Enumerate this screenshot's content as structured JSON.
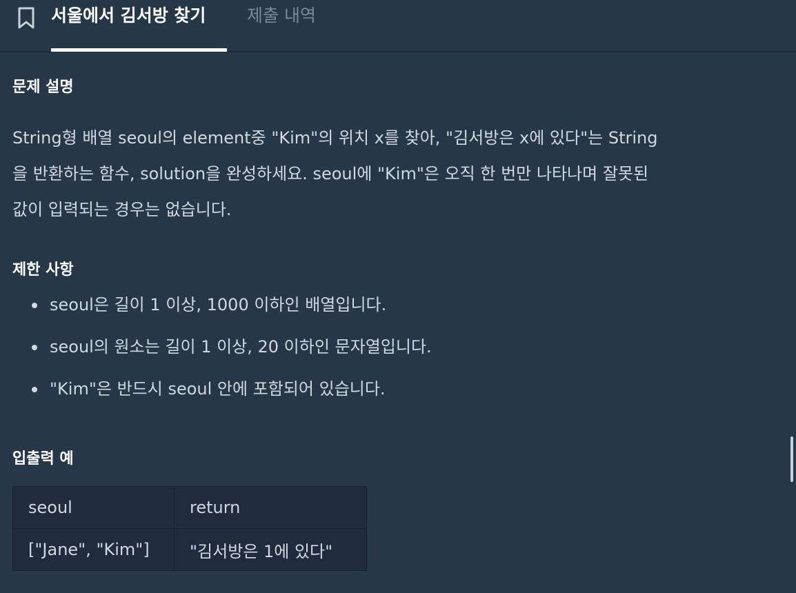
{
  "tabs": {
    "active_label": "서울에서 김서방 찾기",
    "inactive_label": "제출 내역",
    "bookmark_icon": "bookmark-icon"
  },
  "problem": {
    "description_heading": "문제 설명",
    "description_lines": [
      "String형 배열 seoul의 element중 \"Kim\"의 위치 x를 찾아, \"김서방은 x에 있다\"는 String",
      "을 반환하는 함수, solution을 완성하세요. seoul에 \"Kim\"은 오직 한 번만 나타나며 잘못된",
      "값이 입력되는 경우는 없습니다."
    ],
    "constraints_heading": "제한 사항",
    "constraints": [
      "seoul은 길이 1 이상, 1000 이하인 배열입니다.",
      "seoul의 원소는 길이 1 이상, 20 이하인 문자열입니다.",
      "\"Kim\"은 반드시 seoul 안에 포함되어 있습니다."
    ],
    "io_heading": "입출력 예",
    "io_table": {
      "headers": [
        "seoul",
        "return"
      ],
      "rows": [
        [
          "[\"Jane\", \"Kim\"]",
          "\"김서방은 1에 있다\""
        ]
      ]
    }
  },
  "colors": {
    "background": "#263747",
    "text": "#d1d8e0",
    "heading": "#ffffff",
    "inactive_tab": "#78899a",
    "table_bg": "#202b3d"
  }
}
